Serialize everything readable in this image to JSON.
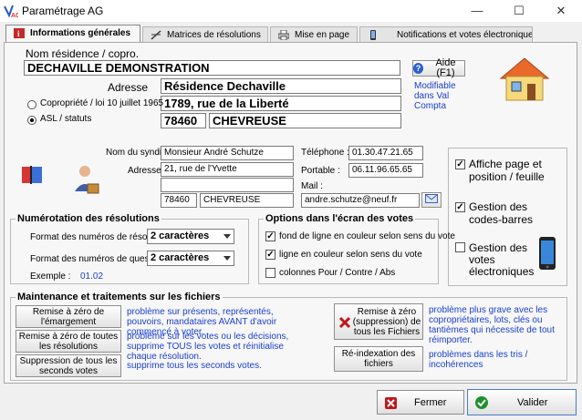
{
  "window": {
    "title": "Paramétrage AG",
    "minimize": "—",
    "maximize": "☐",
    "close": "✕"
  },
  "tabs": [
    {
      "label": "Informations générales",
      "active": true
    },
    {
      "label": "Matrices de résolutions",
      "active": false
    },
    {
      "label": "Mise en page",
      "active": false
    },
    {
      "label": "Notifications et votes électroniques",
      "active": false
    }
  ],
  "general": {
    "name_label": "Nom résidence / copro.",
    "name_value": "DECHAVILLE DEMONSTRATION",
    "address_label": "Adresse",
    "address_name": "Résidence Dechaville",
    "address_street": "1789, rue de la Liberté",
    "postal_code": "78460",
    "city": "CHEVREUSE",
    "radio_copro": "Copropriété / loi 10 juillet 1965",
    "radio_asl": "ASL / statuts",
    "selected_type": "asl",
    "help_button": "Aide (F1)",
    "modifiable_note": "Modifiable dans Val Compta"
  },
  "syndic": {
    "name_label": "Nom du syndic",
    "name_value": "Monsieur André Schutze",
    "address_label": "Adresse",
    "address_line1": "21, rue de l'Yvette",
    "address_line2": "",
    "postal_code": "78460",
    "city": "CHEVREUSE",
    "phone_label": "Téléphone :",
    "phone_value": "01.30.47.21.65",
    "mobile_label": "Portable :",
    "mobile_value": "06.11.96.65.65",
    "mail_label": "Mail :",
    "mail_value": "andre.schutze@neuf.fr"
  },
  "right_options": [
    {
      "label": "Affiche page et position / feuille",
      "checked": true
    },
    {
      "label": "Gestion des codes-barres",
      "checked": true
    },
    {
      "label": "Gestion des votes électroniques",
      "checked": false
    }
  ],
  "numbering": {
    "title": "Numérotation des résolutions",
    "resolution_label": "Format des numéros de résolution",
    "resolution_value": "2 caractères",
    "question_label": "Format des numéros de questions",
    "question_value": "2 caractères",
    "example_label": "Exemple :",
    "example_value": "01.02"
  },
  "vote_options": {
    "title": "Options dans l'écran des votes",
    "items": [
      {
        "label": "fond de ligne en couleur selon sens du vote",
        "checked": true
      },
      {
        "label": "ligne en couleur selon sens du vote",
        "checked": true
      },
      {
        "label": "colonnes Pour / Contre / Abs",
        "checked": false
      }
    ]
  },
  "maintenance": {
    "title": "Maintenance et traitements sur les fichiers",
    "btn_emargement": "Remise à zéro de l'émargement",
    "desc_emargement": "problème sur présents, représentés, pouvoirs, mandataires AVANT d'avoir commencé à voter.",
    "btn_resolutions": "Remise à zéro de toutes les résolutions",
    "desc_resolutions": "problème sur les votes ou les décisions, supprime TOUS les votes et réinitialise chaque résolution.",
    "btn_second_votes": "Suppression de tous les seconds votes",
    "desc_second_votes": "supprime tous les seconds votes.",
    "btn_reset_all": "Remise à zéro (suppression) de tous les Fichiers",
    "desc_reset_all": "problème plus grave avec les copropriétaires, lots, clés ou tantièmes qui nécessite de tout réimporter.",
    "btn_reindex": "Ré-indexation des fichiers",
    "desc_reindex": "problèmes dans les tris / incohérences"
  },
  "footer": {
    "close_label": "Fermer",
    "validate_label": "Valider"
  },
  "colors": {
    "accent_text": "#1a3fcf",
    "close_red": "#c0161b",
    "ok_green": "#1d8f2e"
  },
  "icons": [
    "app-logo-icon",
    "info-icon",
    "matrix-icon",
    "printer-icon",
    "help-icon",
    "house-icon",
    "book-icon",
    "person-icon",
    "email-icon",
    "phone-icon",
    "delete-icon",
    "cancel-icon",
    "check-icon"
  ]
}
